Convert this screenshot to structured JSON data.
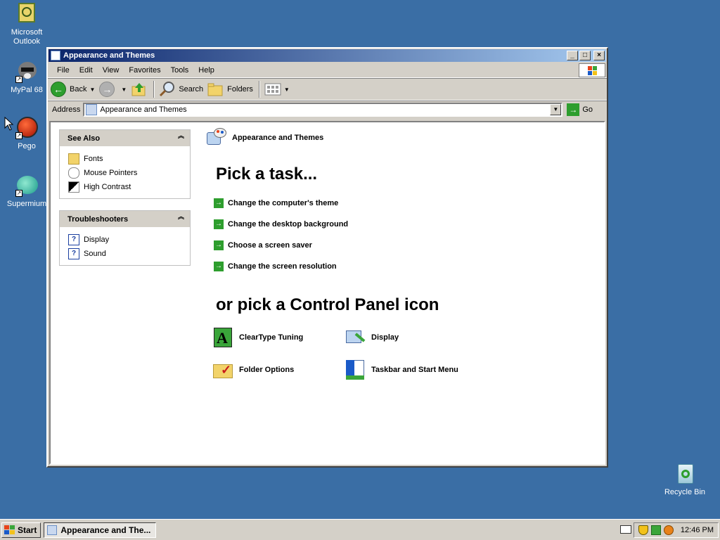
{
  "desktop": {
    "icons": [
      {
        "label_line1": "Microsoft",
        "label_line2": "Outlook",
        "icon": "outlook-icon"
      },
      {
        "label_line1": "MyPal 68",
        "label_line2": "",
        "icon": "mypal-icon"
      },
      {
        "label_line1": "Pego",
        "label_line2": "",
        "icon": "pego-icon"
      },
      {
        "label_line1": "Supermium",
        "label_line2": "",
        "icon": "supermium-icon"
      }
    ],
    "recycle_bin": "Recycle Bin"
  },
  "window": {
    "title": "Appearance and Themes",
    "buttons": {
      "minimize": "_",
      "maximize": "□",
      "close": "×"
    },
    "menu": [
      "File",
      "Edit",
      "View",
      "Favorites",
      "Tools",
      "Help"
    ],
    "toolbar": {
      "back": "Back",
      "search": "Search",
      "folders": "Folders"
    },
    "address": {
      "label": "Address",
      "value": "Appearance and Themes",
      "go": "Go"
    }
  },
  "see_also": {
    "title": "See Also",
    "items": [
      "Fonts",
      "Mouse Pointers",
      "High Contrast"
    ]
  },
  "troubleshooters": {
    "title": "Troubleshooters",
    "items": [
      "Display",
      "Sound"
    ]
  },
  "main": {
    "category_title": "Appearance and Themes",
    "pick_task": "Pick a task...",
    "tasks": [
      "Change the computer's theme",
      "Change the desktop background",
      "Choose a screen saver",
      "Change the screen resolution"
    ],
    "pick_icon": "or pick a Control Panel icon",
    "icons": [
      {
        "label": "ClearType Tuning",
        "icon": "cleartype-icon"
      },
      {
        "label": "Display",
        "icon": "display-icon"
      },
      {
        "label": "Folder Options",
        "icon": "folder-options-icon"
      },
      {
        "label": "Taskbar and Start Menu",
        "icon": "taskbar-start-menu-icon"
      }
    ]
  },
  "taskbar": {
    "start": "Start",
    "active_task": "Appearance and The...",
    "clock": "12:46 PM"
  }
}
